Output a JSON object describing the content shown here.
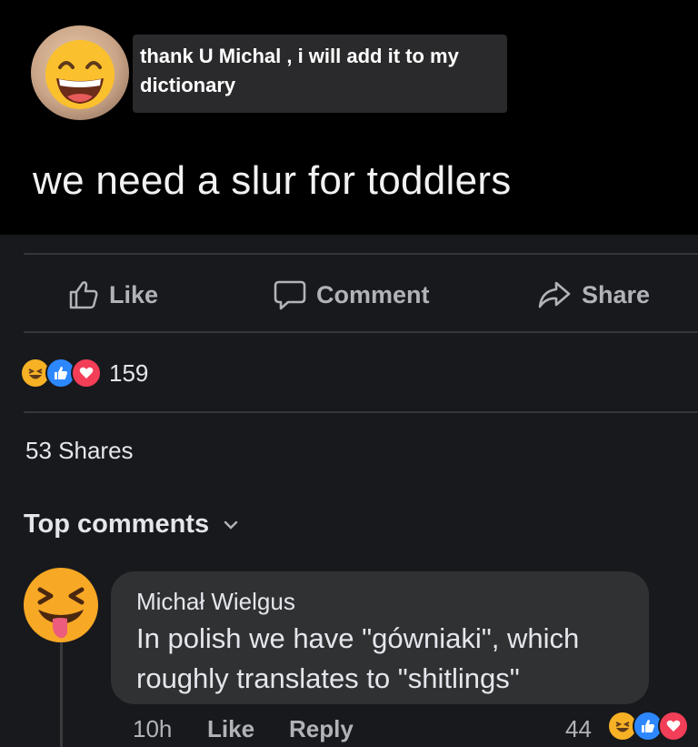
{
  "caption": "thank U Michal , i will add it to my dictionary",
  "post": {
    "text": "we need a slur for toddlers"
  },
  "actions": {
    "like": "Like",
    "comment": "Comment",
    "share": "Share"
  },
  "reactions": {
    "count": "159",
    "types": [
      "haha-icon",
      "like-icon",
      "love-icon"
    ]
  },
  "shares": "53 Shares",
  "comments_header": "Top comments",
  "comment": {
    "author": "Michał Wielgus",
    "text": "In polish we have \"gówniaki\", which roughly translates to \"shitlings\"",
    "time": "10h",
    "like": "Like",
    "reply": "Reply",
    "reaction_count": "44"
  },
  "colors": {
    "background": "#000000",
    "card": "#18191c",
    "bubble": "#303133",
    "like_blue": "#2d88ff",
    "love_red": "#f33e58",
    "haha_yellow": "#f7b125"
  }
}
